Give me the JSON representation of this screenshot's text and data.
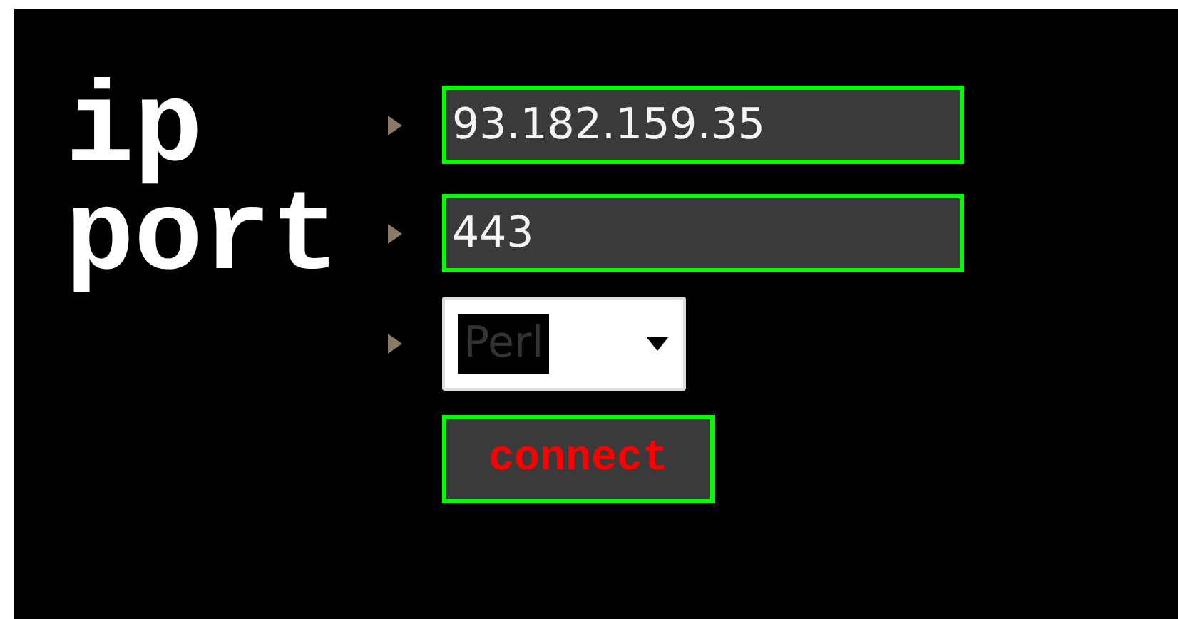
{
  "rows": [
    {
      "kind": "text",
      "label": "ip",
      "value": "93.182.159.35"
    },
    {
      "kind": "text",
      "label": "port",
      "value": "443"
    },
    {
      "kind": "select",
      "value": "Perl"
    },
    {
      "kind": "button",
      "text": "connect"
    }
  ]
}
